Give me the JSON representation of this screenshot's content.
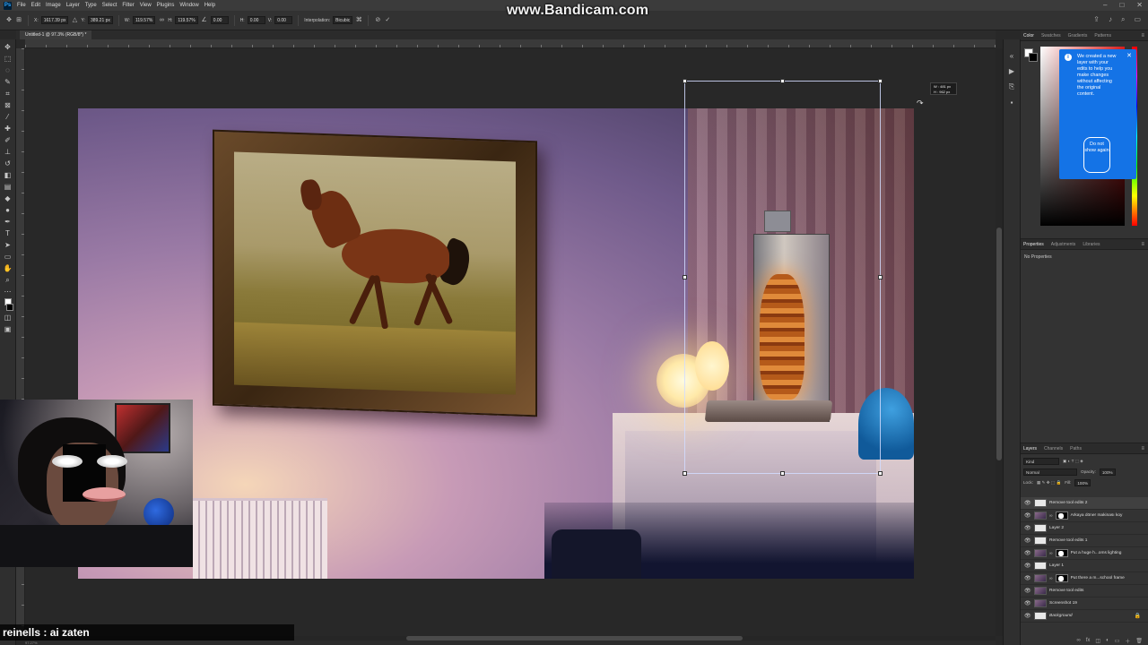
{
  "watermark": "www.Bandicam.com",
  "menu": [
    "File",
    "Edit",
    "Image",
    "Layer",
    "Type",
    "Select",
    "Filter",
    "View",
    "Plugins",
    "Window",
    "Help"
  ],
  "options_bar": {
    "x_label": "X:",
    "x_value": "1617.39 px",
    "y_label": "Y:",
    "y_value": "389.21 px",
    "w_label": "W:",
    "w_value": "119.57%",
    "h_label": "H:",
    "h_value": "119.57%",
    "angle_value": "0.00",
    "hskew_label": "H:",
    "hskew_value": "0.00",
    "vskew_label": "V:",
    "vskew_value": "0.00",
    "interp_label": "Interpolation:",
    "interp_value": "Bicubic"
  },
  "document": {
    "tab_title": "Untitled-1 @ 97.3% (RGB/8*) *",
    "status": "97.27%"
  },
  "transform_tooltip": {
    "w": "W : 481 px",
    "h": "H : 962 px"
  },
  "color_panel": {
    "tabs": [
      "Color",
      "Swatches",
      "Gradients",
      "Patterns"
    ]
  },
  "notice": {
    "text": "We created a new layer with your edits to help you make changes without affecting the original content.",
    "button": "Do not show again"
  },
  "properties_panel": {
    "tabs": [
      "Properties",
      "Adjustments",
      "Libraries"
    ],
    "empty_text": "No Properties"
  },
  "layers_panel": {
    "tabs": [
      "Layers",
      "Channels",
      "Paths"
    ],
    "kind_placeholder": "Kind",
    "blend_mode": "Normal",
    "opacity_label": "Opacity:",
    "opacity_value": "100%",
    "lock_label": "Lock:",
    "fill_label": "Fill:",
    "fill_value": "100%",
    "layers": [
      {
        "name": "Remove tool edits 2",
        "mask": false,
        "selected": true
      },
      {
        "name": "Arkaya döner makinası koy",
        "mask": true,
        "selected": false
      },
      {
        "name": "Layer 2",
        "mask": false,
        "selected": false
      },
      {
        "name": "Remove tool edits 1",
        "mask": false,
        "selected": false
      },
      {
        "name": "Put a huge h...oms lighting",
        "mask": true,
        "selected": false
      },
      {
        "name": "Layer 1",
        "mask": false,
        "selected": false
      },
      {
        "name": "Put there a m...school frame",
        "mask": true,
        "selected": false
      },
      {
        "name": "Remove tool edits",
        "mask": false,
        "selected": false
      },
      {
        "name": "Screenshot 19",
        "mask": false,
        "selected": false
      },
      {
        "name": "Background",
        "mask": false,
        "selected": false,
        "locked": true
      }
    ]
  },
  "chat": {
    "user": "reinells",
    "message": " : ai zaten"
  }
}
